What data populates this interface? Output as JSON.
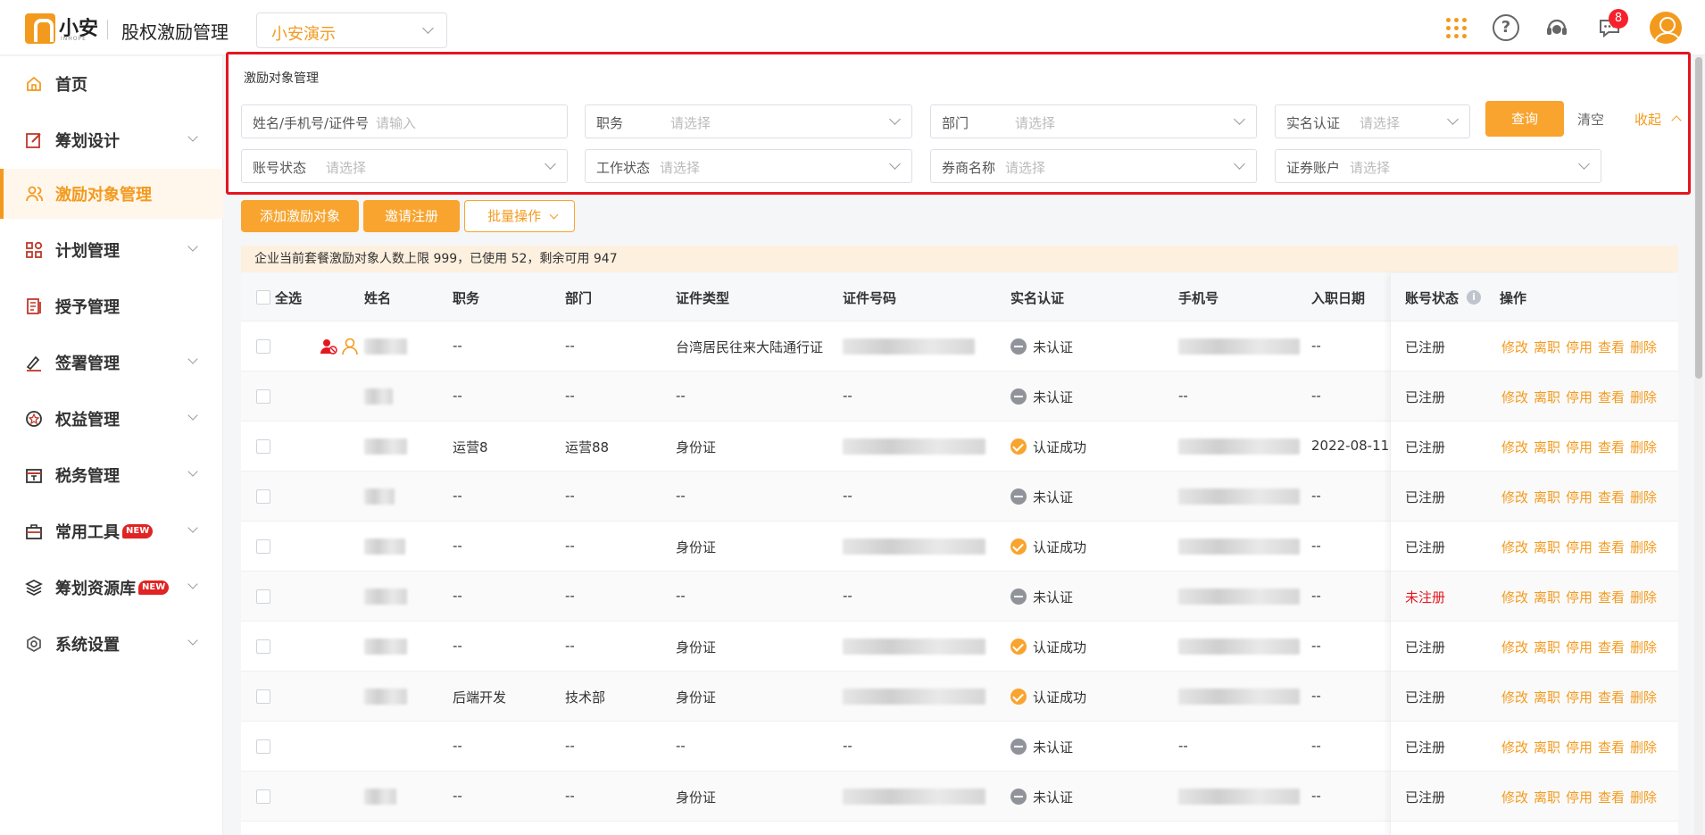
{
  "header": {
    "brand": "小安",
    "brand_sub": "INHOPE",
    "app_title": "股权激励管理",
    "company": "小安演示",
    "notification_count": "8",
    "accent_color": "#f39a1e"
  },
  "sidebar": {
    "items": [
      {
        "label": "首页",
        "icon": "home-icon"
      },
      {
        "label": "筹划设计",
        "icon": "edit-icon"
      },
      {
        "label": "激励对象管理",
        "icon": "users-icon",
        "active": true
      },
      {
        "label": "计划管理",
        "icon": "apps-icon"
      },
      {
        "label": "授予管理",
        "icon": "document-icon"
      },
      {
        "label": "签署管理",
        "icon": "sign-icon"
      },
      {
        "label": "权益管理",
        "icon": "award-icon"
      },
      {
        "label": "税务管理",
        "icon": "tax-icon"
      },
      {
        "label": "常用工具",
        "icon": "toolbox-icon",
        "tag": "NEW"
      },
      {
        "label": "筹划资源库",
        "icon": "layers-icon",
        "tag": "NEW"
      },
      {
        "label": "系统设置",
        "icon": "settings-icon"
      }
    ]
  },
  "search": {
    "title": "激励对象管理",
    "fields": {
      "name": {
        "label": "姓名/手机号/证件号",
        "placeholder": "请输入"
      },
      "position": {
        "label": "职务",
        "placeholder": "请选择"
      },
      "department": {
        "label": "部门",
        "placeholder": "请选择"
      },
      "verification": {
        "label": "实名认证",
        "placeholder": "请选择"
      },
      "account_status": {
        "label": "账号状态",
        "placeholder": "请选择"
      },
      "work_status": {
        "label": "工作状态",
        "placeholder": "请选择"
      },
      "broker": {
        "label": "券商名称",
        "placeholder": "请选择"
      },
      "securities_account": {
        "label": "证券账户",
        "placeholder": "请选择"
      }
    },
    "query_label": "查询",
    "clear_label": "清空",
    "collapse_label": "收起"
  },
  "toolbar": {
    "add_label": "添加激励对象",
    "invite_label": "邀请注册",
    "batch_label": "批量操作"
  },
  "quota_text": "企业当前套餐激励对象人数上限 999，已使用 52，剩余可用 947",
  "table": {
    "headers": {
      "select_all": "全选",
      "name": "姓名",
      "position": "职务",
      "department": "部门",
      "id_type": "证件类型",
      "id_number": "证件号码",
      "verification": "实名认证",
      "phone": "手机号",
      "join_date": "入职日期",
      "account_status": "账号状态",
      "actions": "操作"
    },
    "actions": [
      "修改",
      "离职",
      "停用",
      "查看",
      "删除"
    ],
    "rows": [
      {
        "position": "--",
        "department": "--",
        "id_type": "台湾居民往来大陆通行证",
        "id_number": "",
        "verification": "未认证",
        "verified": false,
        "phone": "",
        "join_date": "--",
        "account_status": "已注册"
      },
      {
        "position": "--",
        "department": "--",
        "id_type": "--",
        "id_number": "--",
        "verification": "未认证",
        "verified": false,
        "phone": "--",
        "join_date": "--",
        "account_status": "已注册"
      },
      {
        "position": "运营8",
        "department": "运营88",
        "id_type": "身份证",
        "id_number": "",
        "verification": "认证成功",
        "verified": true,
        "phone": "",
        "join_date": "2022-08-11",
        "account_status": "已注册"
      },
      {
        "position": "--",
        "department": "--",
        "id_type": "--",
        "id_number": "--",
        "verification": "未认证",
        "verified": false,
        "phone": "",
        "join_date": "--",
        "account_status": "已注册"
      },
      {
        "position": "--",
        "department": "--",
        "id_type": "身份证",
        "id_number": "",
        "verification": "认证成功",
        "verified": true,
        "phone": "",
        "join_date": "--",
        "account_status": "已注册"
      },
      {
        "position": "--",
        "department": "--",
        "id_type": "--",
        "id_number": "--",
        "verification": "未认证",
        "verified": false,
        "phone": "",
        "join_date": "--",
        "account_status": "未注册"
      },
      {
        "position": "--",
        "department": "--",
        "id_type": "身份证",
        "id_number": "",
        "verification": "认证成功",
        "verified": true,
        "phone": "",
        "join_date": "--",
        "account_status": "已注册"
      },
      {
        "position": "后端开发",
        "department": "技术部",
        "id_type": "身份证",
        "id_number": "",
        "verification": "认证成功",
        "verified": true,
        "phone": "",
        "join_date": "--",
        "account_status": "已注册"
      },
      {
        "position": "--",
        "department": "--",
        "id_type": "--",
        "id_number": "--",
        "verification": "未认证",
        "verified": false,
        "phone": "--",
        "join_date": "--",
        "account_status": "已注册"
      },
      {
        "position": "--",
        "department": "--",
        "id_type": "身份证",
        "id_number": "",
        "verification": "未认证",
        "verified": false,
        "phone": "",
        "join_date": "--",
        "account_status": "已注册"
      }
    ]
  }
}
